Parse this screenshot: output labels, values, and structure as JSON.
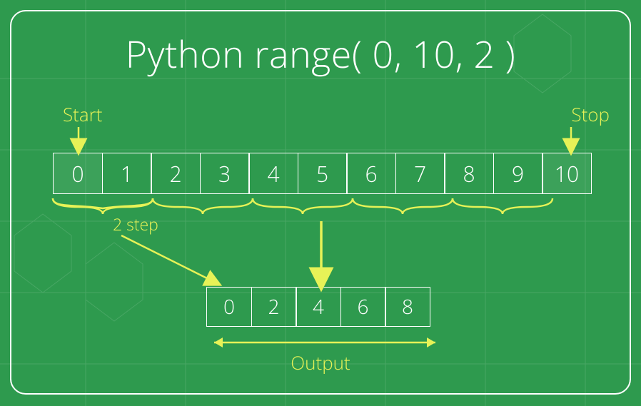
{
  "title": "Python range( 0, 10, 2 )",
  "labels": {
    "start": "Start",
    "stop": "Stop",
    "step": "2 step",
    "output": "Output"
  },
  "source_values": [
    "0",
    "1",
    "2",
    "3",
    "4",
    "5",
    "6",
    "7",
    "8",
    "9",
    "10"
  ],
  "output_values": [
    "0",
    "2",
    "4",
    "6",
    "8"
  ],
  "highlight_indices": [
    0,
    10
  ],
  "colors": {
    "bg": "#2e9a4e",
    "accent": "#e7f257",
    "line": "#ffffff"
  }
}
